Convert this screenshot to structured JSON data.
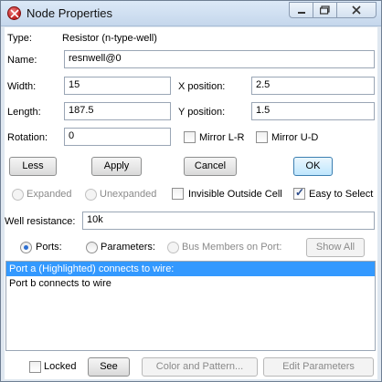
{
  "window": {
    "title": "Node Properties"
  },
  "type": {
    "label": "Type:",
    "value": "Resistor (n-type-well)"
  },
  "name": {
    "label": "Name:",
    "value": "resnwell@0"
  },
  "width": {
    "label": "Width:",
    "value": "15"
  },
  "xpos": {
    "label": "X position:",
    "value": "2.5"
  },
  "length": {
    "label": "Length:",
    "value": "187.5"
  },
  "ypos": {
    "label": "Y position:",
    "value": "1.5"
  },
  "rotation": {
    "label": "Rotation:",
    "value": "0"
  },
  "mirror_lr": {
    "label": "Mirror L-R",
    "checked": false
  },
  "mirror_ud": {
    "label": "Mirror U-D",
    "checked": false
  },
  "buttons": {
    "less": "Less",
    "apply": "Apply",
    "cancel": "Cancel",
    "ok": "OK"
  },
  "expand": {
    "expanded": "Expanded",
    "unexpanded": "Unexpanded"
  },
  "invisible_outside_cell": {
    "label": "Invisible Outside Cell",
    "checked": false
  },
  "easy_to_select": {
    "label": "Easy to Select",
    "checked": true
  },
  "well_resistance": {
    "label": "Well resistance:",
    "value": "10k"
  },
  "list_mode": {
    "ports": "Ports:",
    "parameters": "Parameters:",
    "bus_members": "Bus Members on Port:",
    "show_all": "Show All",
    "selected": "Ports:"
  },
  "list_items": [
    "Port a (Highlighted) connects to wire:",
    "Port b connects to wire"
  ],
  "bottom": {
    "locked": "Locked",
    "see": "See",
    "color_pattern": "Color and Pattern...",
    "edit_parameters": "Edit Parameters"
  },
  "colors": {
    "selection": "#3399ff",
    "titlebar": "#c5d7ec"
  }
}
